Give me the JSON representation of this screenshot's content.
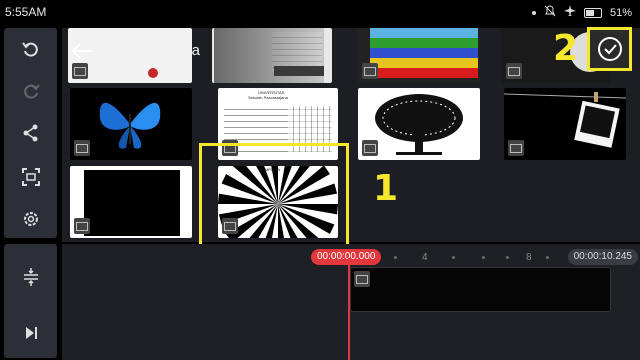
{
  "status_bar": {
    "time": "5:55AM",
    "battery": "51%"
  },
  "browser": {
    "title": "DCIM/ Camera"
  },
  "annotations": {
    "label_1": "1",
    "label_2": "2"
  },
  "timeline": {
    "start_time": "00:00:00.000",
    "end_time": "00:00:10.245",
    "ruler_ticks": [
      "4",
      "8"
    ]
  },
  "thumbnail_text": {
    "doc1_line1": "UNIVERSITAS",
    "doc1_line2": "Sekolah Pascasarjana",
    "test_chart_title": "LAMPIRAN"
  },
  "colors": {
    "accent_yellow": "#f5e82c",
    "playhead_red": "#e2373c",
    "panel_bg": "#1c1e24",
    "toolbar_bg": "#2c2f38"
  },
  "icons": {
    "undo": "undo-icon",
    "redo": "redo-icon",
    "share": "share-icon",
    "crop": "crop-icon",
    "settings": "settings-icon",
    "adjust": "adjust-icon",
    "play_end": "skip-end-icon",
    "back": "back-arrow-icon",
    "done": "check-circle-icon"
  }
}
